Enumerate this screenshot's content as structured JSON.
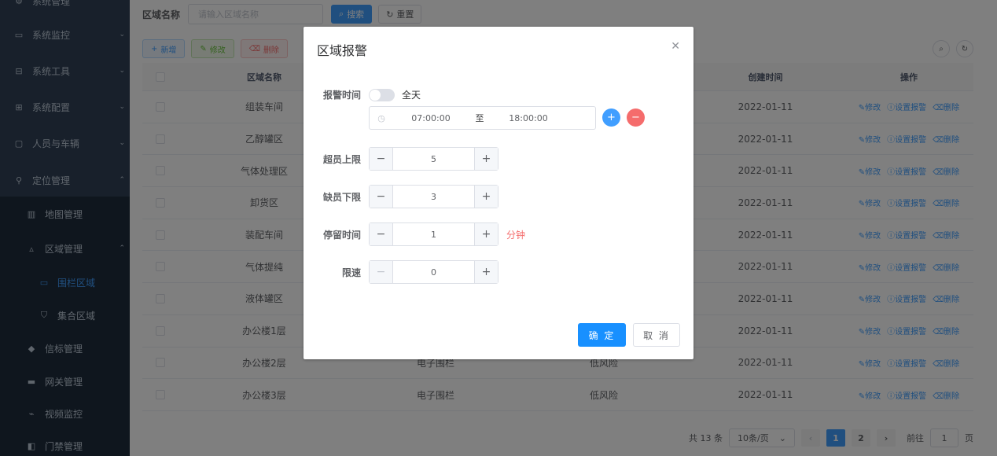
{
  "sidebar": {
    "items": [
      {
        "label": "系统管理",
        "icon": "settings-icon"
      },
      {
        "label": "系统监控",
        "icon": "monitor-icon"
      },
      {
        "label": "系统工具",
        "icon": "toolbox-icon"
      },
      {
        "label": "系统配置",
        "icon": "config-icon"
      },
      {
        "label": "人员与车辆",
        "icon": "people-icon"
      },
      {
        "label": "定位管理",
        "icon": "location-icon"
      },
      {
        "label": "地图管理",
        "icon": "map-icon"
      },
      {
        "label": "区域管理",
        "icon": "area-icon"
      },
      {
        "label": "围栏区域",
        "icon": "fence-icon"
      },
      {
        "label": "集合区域",
        "icon": "shield-icon"
      },
      {
        "label": "信标管理",
        "icon": "beacon-icon"
      },
      {
        "label": "网关管理",
        "icon": "gateway-icon"
      },
      {
        "label": "视频监控",
        "icon": "camera-icon"
      },
      {
        "label": "门禁管理",
        "icon": "door-icon"
      }
    ]
  },
  "search": {
    "label": "区域名称",
    "placeholder": "请输入区域名称",
    "search_btn": "搜索",
    "reset_btn": "重置"
  },
  "toolbar": {
    "add": "新增",
    "edit": "修改",
    "delete": "删除"
  },
  "table": {
    "headers": [
      "区域名称",
      "",
      "",
      "创建时间",
      "操作"
    ],
    "ops": {
      "edit": "修改",
      "alarm": "设置报警",
      "delete": "删除"
    },
    "rows": [
      {
        "name": "组装车间",
        "type": "",
        "risk": "",
        "created": "2022-01-11"
      },
      {
        "name": "乙醇罐区",
        "type": "",
        "risk": "",
        "created": "2022-01-11"
      },
      {
        "name": "气体处理区",
        "type": "",
        "risk": "",
        "created": "2022-01-11"
      },
      {
        "name": "卸货区",
        "type": "",
        "risk": "",
        "created": "2022-01-11"
      },
      {
        "name": "装配车间",
        "type": "",
        "risk": "",
        "created": "2022-01-11"
      },
      {
        "name": "气体提纯",
        "type": "",
        "risk": "",
        "created": "2022-01-11"
      },
      {
        "name": "液体罐区",
        "type": "",
        "risk": "",
        "created": "2022-01-11"
      },
      {
        "name": "办公楼1层",
        "type": "",
        "risk": "",
        "created": "2022-01-11"
      },
      {
        "name": "办公楼2层",
        "type": "电子围栏",
        "risk": "低风险",
        "created": "2022-01-11"
      },
      {
        "name": "办公楼3层",
        "type": "电子围栏",
        "risk": "低风险",
        "created": "2022-01-11"
      }
    ]
  },
  "pager": {
    "total": "共 13 条",
    "page_size": "10条/页",
    "pages": [
      "1",
      "2"
    ],
    "goto_label": "前往",
    "goto_value": "1",
    "page_unit": "页"
  },
  "dialog": {
    "title": "区域报警",
    "alarm_time_label": "报警时间",
    "all_day_label": "全天",
    "start_time": "07:00:00",
    "separator": "至",
    "end_time": "18:00:00",
    "over_limit_label": "超员上限",
    "over_limit_value": "5",
    "under_limit_label": "缺员下限",
    "under_limit_value": "3",
    "stay_label": "停留时间",
    "stay_value": "1",
    "stay_unit": "分钟",
    "speed_label": "限速",
    "speed_value": "0",
    "ok": "确 定",
    "cancel": "取 消"
  }
}
